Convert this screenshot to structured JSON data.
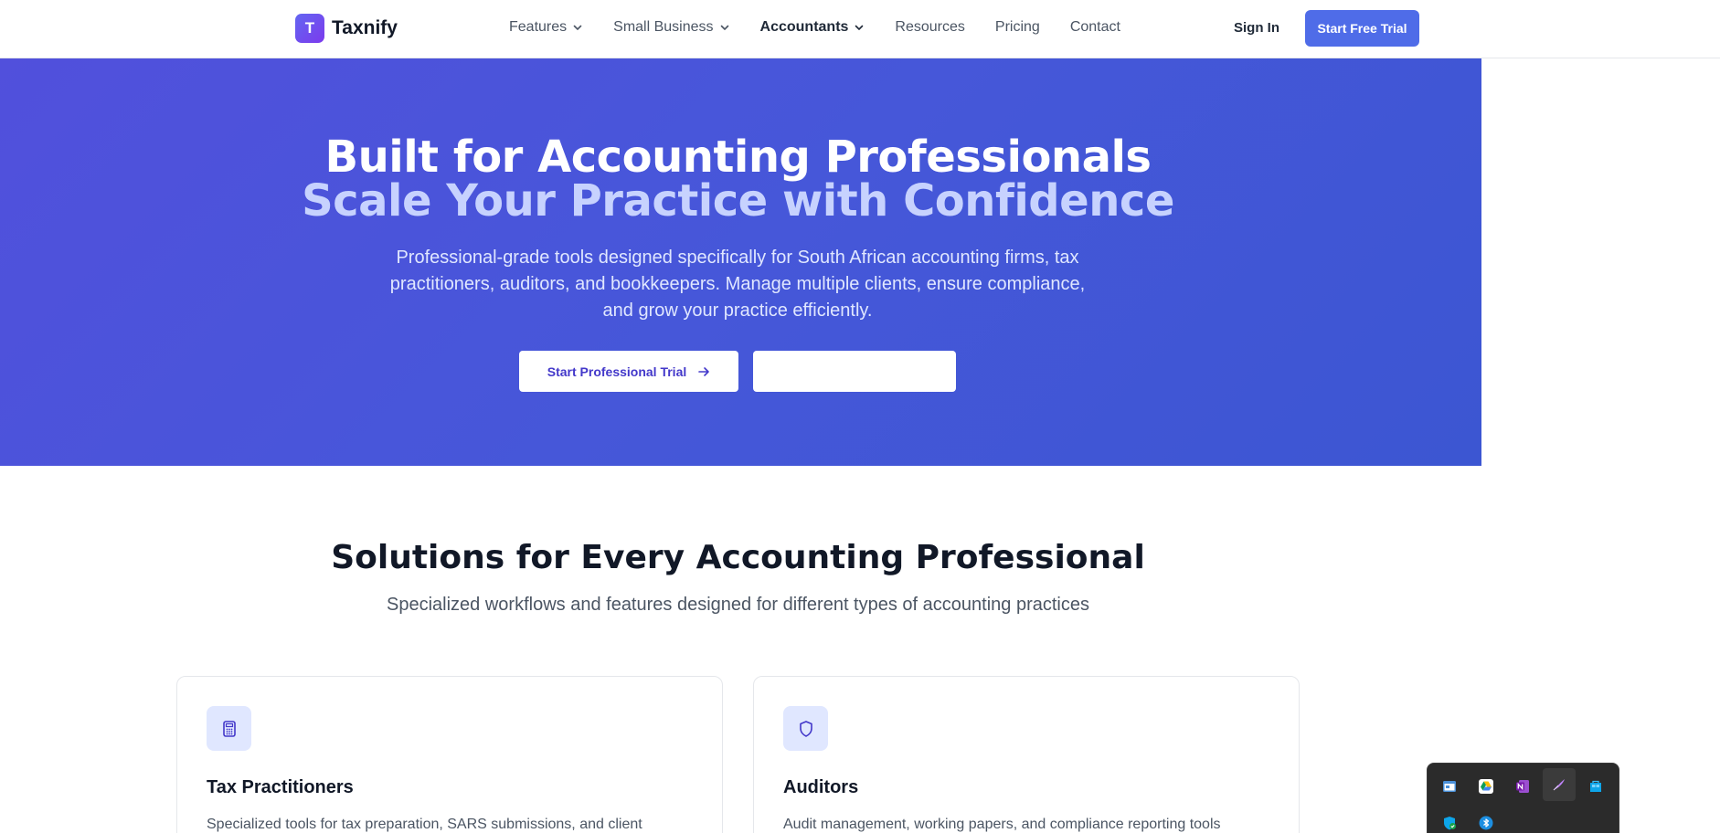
{
  "nav": {
    "logo_letter": "T",
    "logo_text": "Taxnify",
    "menu": [
      {
        "label": "Features",
        "dropdown": true
      },
      {
        "label": "Small Business",
        "dropdown": true
      },
      {
        "label": "Accountants",
        "dropdown": true,
        "active": true
      },
      {
        "label": "Resources",
        "dropdown": false
      },
      {
        "label": "Pricing",
        "dropdown": false
      },
      {
        "label": "Contact",
        "dropdown": false
      }
    ],
    "sign_in": "Sign In",
    "cta": "Start Free Trial"
  },
  "hero": {
    "title_line1": "Built for Accounting Professionals",
    "title_line2": "Scale Your Practice with Confidence",
    "subtitle": "Professional-grade tools designed specifically for South African accounting firms, tax practitioners, auditors, and bookkeepers. Manage multiple clients, ensure compliance, and grow your practice efficiently.",
    "primary_button": "Start Professional Trial",
    "secondary_button": ""
  },
  "solutions": {
    "title": "Solutions for Every Accounting Professional",
    "subtitle": "Specialized workflows and features designed for different types of accounting practices",
    "cards": [
      {
        "icon": "calculator-icon",
        "title": "Tax Practitioners",
        "description": "Specialized tools for tax preparation, SARS submissions, and client compliance"
      },
      {
        "icon": "shield-icon",
        "title": "Auditors",
        "description": "Audit management, working papers, and compliance reporting tools"
      }
    ]
  },
  "tray": {
    "icons": [
      "window-app-icon",
      "google-drive-icon",
      "onenote-icon",
      "pen-icon",
      "store-icon",
      "defender-icon",
      "bluetooth-icon"
    ]
  },
  "colors": {
    "accent": "#4f6ce8",
    "hero_start": "#5150dc",
    "hero_end": "#3c56d2",
    "hero_title_secondary": "#c7d2fe"
  }
}
